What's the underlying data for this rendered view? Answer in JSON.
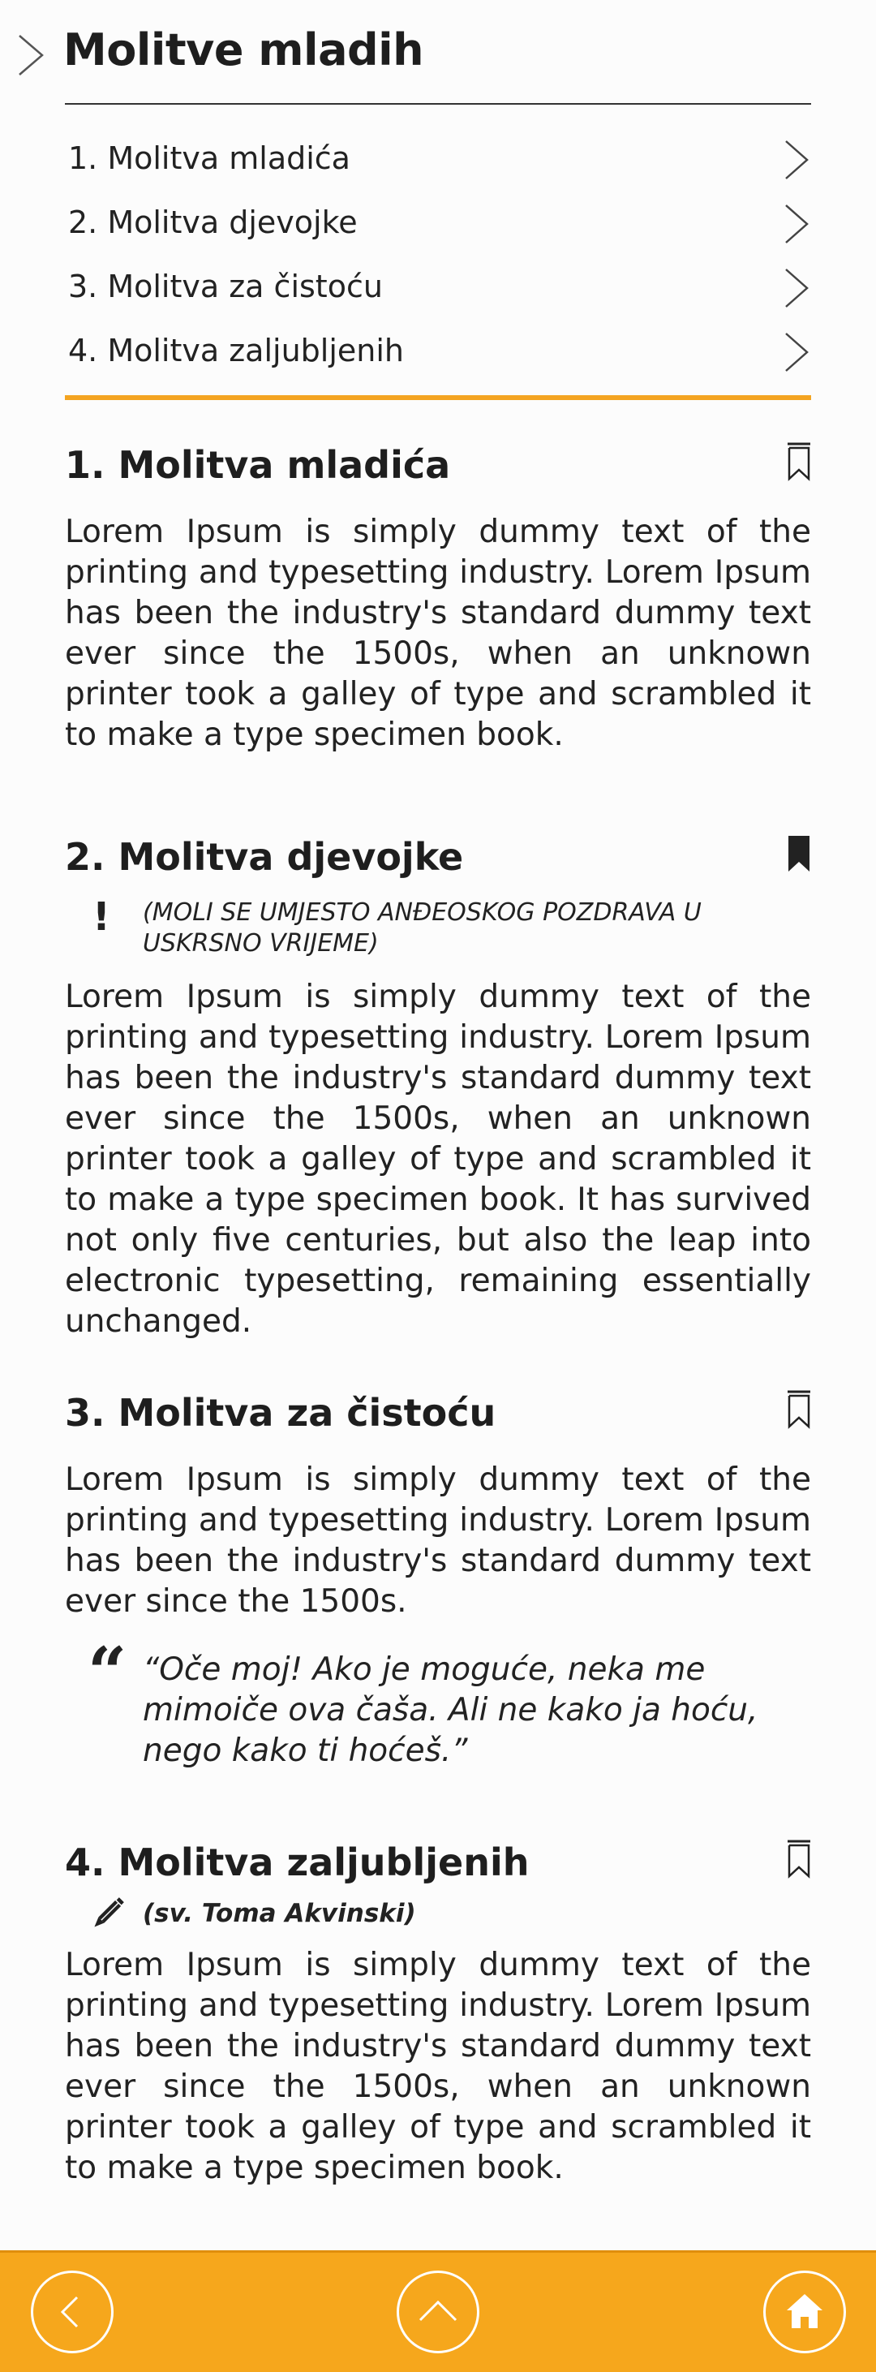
{
  "header": {
    "title": "Molitve mladih"
  },
  "toc": [
    {
      "label": "1. Molitva mladića"
    },
    {
      "label": "2. Molitva djevojke"
    },
    {
      "label": "3. Molitva za čistoću"
    },
    {
      "label": "4. Molitva zaljubljenih"
    }
  ],
  "sections": [
    {
      "title": "1. Molitva mladića",
      "bookmarked": false,
      "body": "Lorem Ipsum is simply dummy text of the printing and typesetting industry. Lorem Ipsum has been the industry's standard dummy text ever since the 1500s, when an unknown printer took a galley of type and scrambled it to make a type specimen book."
    },
    {
      "title": "2. Molitva djevojke",
      "bookmarked": true,
      "note": "(MOLI SE UMJESTO ANĐEOSKOG POZDRAVA U USKRSNO VRIJEME)",
      "body": "Lorem Ipsum is simply dummy text of the printing and typesetting industry. Lorem Ipsum has been the industry's standard dummy text ever since the 1500s, when an unknown printer took a galley of type and scrambled it to make a type specimen book. It has survived not only five centuries, but also the leap into electronic typesetting, remaining essentially unchanged."
    },
    {
      "title": "3. Molitva za čistoću",
      "bookmarked": false,
      "body": "Lorem Ipsum is simply dummy text of the printing and typesetting industry. Lorem Ipsum has been the industry's standard dummy text ever since the 1500s.",
      "quote": "“Oče moj! Ako je moguće, neka me mimoiče ova čaša. Ali ne kako ja hoću, nego kako ti hoćeš.”"
    },
    {
      "title": "4. Molitva zaljubljenih",
      "bookmarked": false,
      "author": "(sv. Toma Akvinski)",
      "body": "Lorem Ipsum is simply dummy text of the printing and typesetting industry. Lorem Ipsum has been the industry's standard dummy text ever since the 1500s, when an unknown printer took a galley of type and scrambled it to make a type specimen book."
    }
  ],
  "footer": {
    "buttons": [
      {
        "icon": "chevron-left-icon"
      },
      {
        "icon": "chevron-up-icon"
      },
      {
        "icon": "home-icon"
      }
    ]
  },
  "colors": {
    "accent": "#f6a71c",
    "text": "#222222",
    "background": "#fcfcfc"
  }
}
